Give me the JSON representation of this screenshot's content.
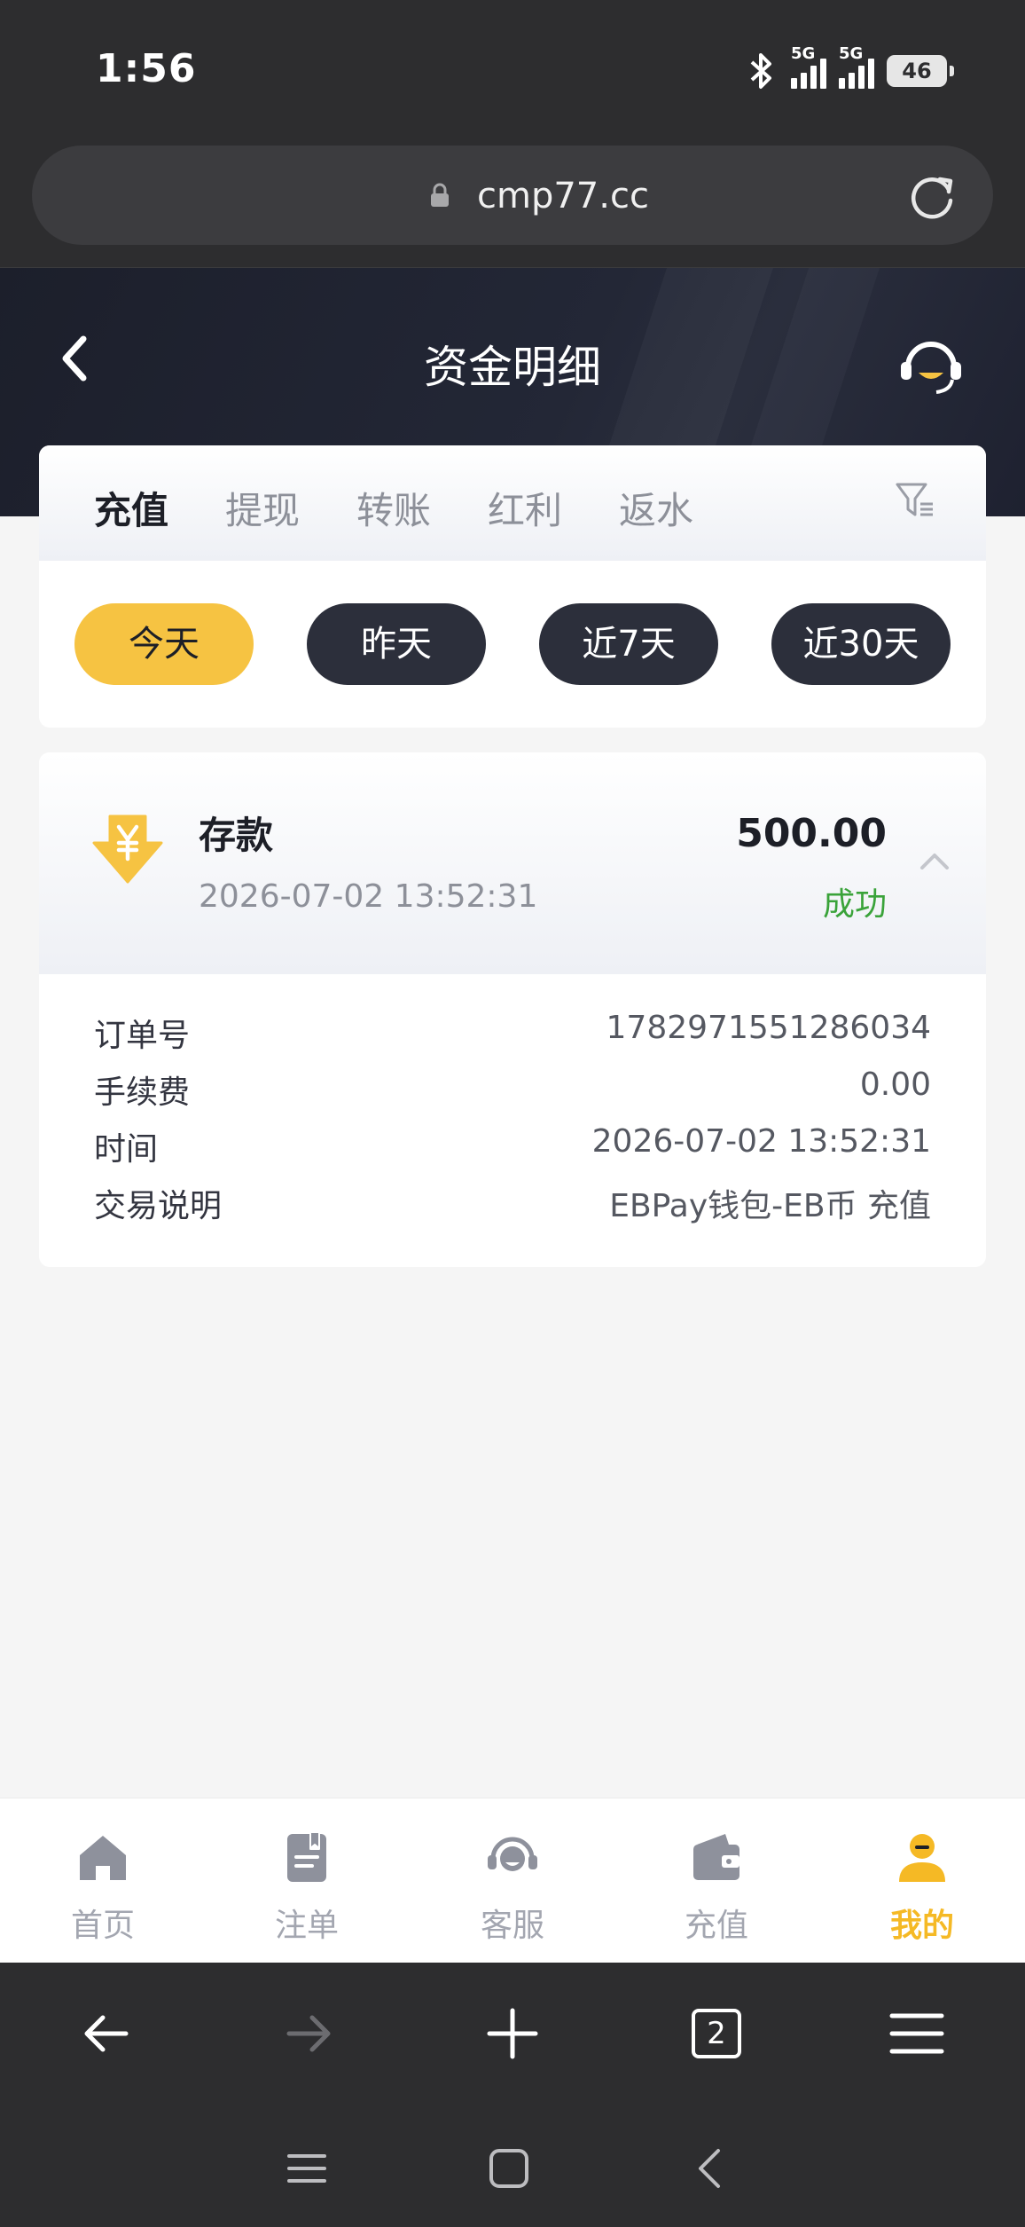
{
  "status_bar": {
    "time": "1:56",
    "signal1_label": "5G",
    "signal2_label": "5G",
    "battery": "46"
  },
  "browser": {
    "url": "cmp77.cc",
    "tab_count": "2"
  },
  "header": {
    "title": "资金明细"
  },
  "tabs": [
    "充值",
    "提现",
    "转账",
    "红利",
    "返水"
  ],
  "active_tab": "充值",
  "date_filters": [
    "今天",
    "昨天",
    "近7天",
    "近30天"
  ],
  "active_date_filter": "今天",
  "record": {
    "type": "存款",
    "time": "2026-07-02 13:52:31",
    "amount": "500.00",
    "status": "成功",
    "status_color": "#3aa33a",
    "details": [
      {
        "label": "订单号",
        "value": "1782971551286034"
      },
      {
        "label": "手续费",
        "value": "0.00"
      },
      {
        "label": "时间",
        "value": "2026-07-02 13:52:31"
      },
      {
        "label": "交易说明",
        "value": "EBPay钱包-EB币 充值"
      }
    ]
  },
  "bottom_nav": [
    {
      "label": "首页",
      "icon": "home-icon"
    },
    {
      "label": "注单",
      "icon": "clipboard-icon"
    },
    {
      "label": "客服",
      "icon": "headset-icon"
    },
    {
      "label": "充值",
      "icon": "wallet-icon"
    },
    {
      "label": "我的",
      "icon": "user-icon"
    }
  ],
  "active_nav": "我的",
  "colors": {
    "accent": "#f6c342",
    "header_bg": "#1c1f2b",
    "chip_dark": "#2c2f3b",
    "success": "#3aa33a"
  }
}
